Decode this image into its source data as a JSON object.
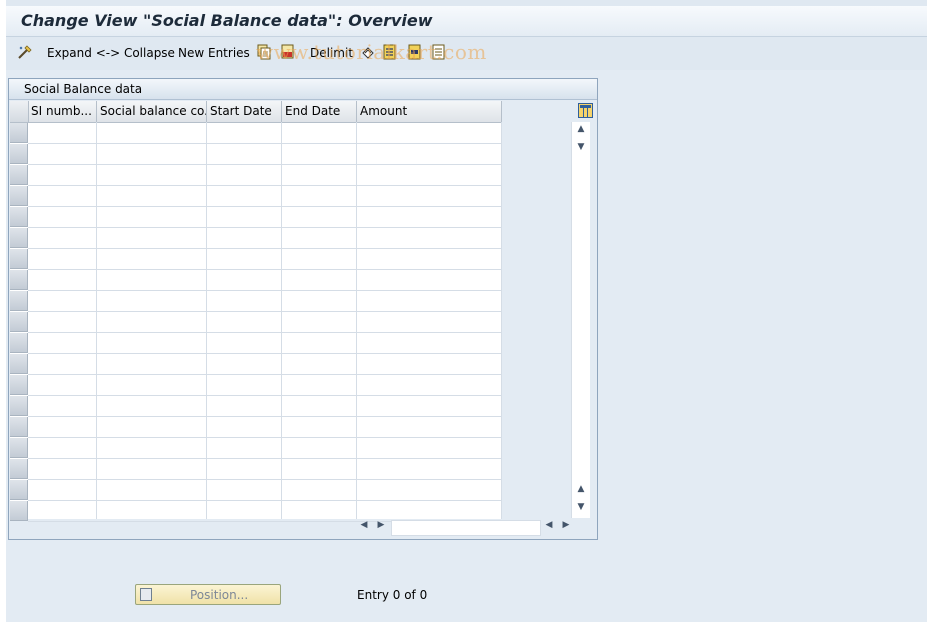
{
  "window": {
    "title": "Change View \"Social Balance data\": Overview"
  },
  "toolbar": {
    "expand_collapse_label": "Expand <-> Collapse",
    "new_entries_label": "New Entries",
    "delimit_label": "Delimit",
    "watermark": "www.tutorialkart.com"
  },
  "panel": {
    "title": "Social Balance data"
  },
  "table": {
    "columns": [
      "SI numb...",
      "Social balance co...",
      "Start Date",
      "End Date",
      "Amount"
    ],
    "rows": []
  },
  "footer": {
    "position_label": "Position...",
    "entry_text": "Entry 0 of 0"
  },
  "colors": {
    "background": "#dfe8f1",
    "panel_border": "#8fa5bd",
    "button_bg": "#f0e2a8"
  }
}
